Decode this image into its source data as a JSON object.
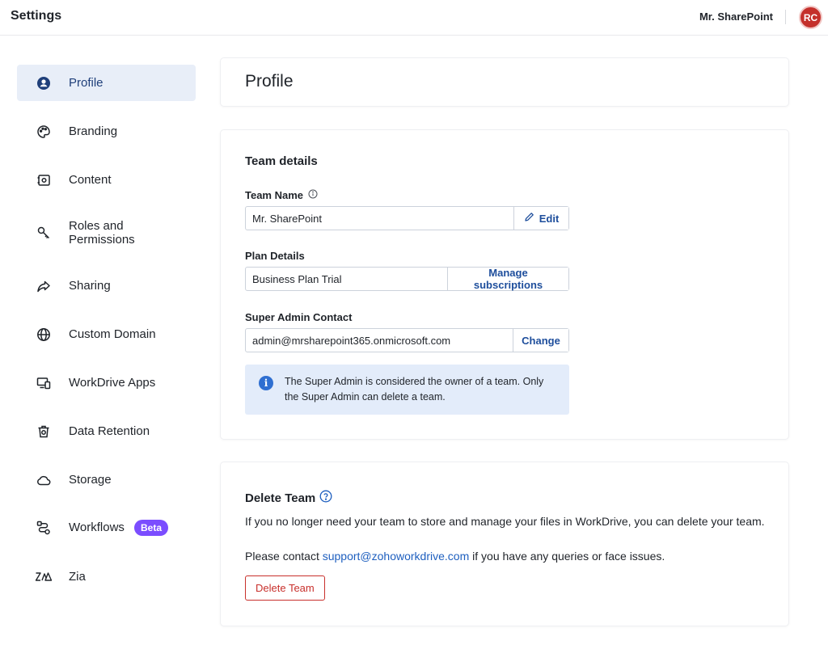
{
  "header": {
    "title": "Settings",
    "user_name": "Mr. SharePoint",
    "avatar_initials": "RC"
  },
  "sidebar": {
    "items": [
      {
        "label": "Profile",
        "icon": "profile-icon",
        "active": true
      },
      {
        "label": "Branding",
        "icon": "palette-icon"
      },
      {
        "label": "Content",
        "icon": "content-icon"
      },
      {
        "label": "Roles and Permissions",
        "icon": "key-icon"
      },
      {
        "label": "Sharing",
        "icon": "share-icon"
      },
      {
        "label": "Custom Domain",
        "icon": "globe-icon"
      },
      {
        "label": "WorkDrive Apps",
        "icon": "devices-icon"
      },
      {
        "label": "Data Retention",
        "icon": "trash-icon"
      },
      {
        "label": "Storage",
        "icon": "cloud-icon"
      },
      {
        "label": "Workflows",
        "icon": "workflow-icon",
        "badge": "Beta"
      },
      {
        "label": "Zia",
        "icon": "zia-icon"
      }
    ]
  },
  "profile": {
    "page_title": "Profile"
  },
  "team_details": {
    "section_title": "Team details",
    "team_name_label": "Team Name",
    "team_name_value": "Mr. SharePoint",
    "edit_label": "Edit",
    "plan_label": "Plan Details",
    "plan_value": "Business Plan Trial",
    "manage_label": "Manage subscriptions",
    "admin_label": "Super Admin Contact",
    "admin_value": "admin@mrsharepoint365.onmicrosoft.com",
    "change_label": "Change",
    "info_text": "The Super Admin is considered the owner of a team. Only the Super Admin can delete a team."
  },
  "delete_team": {
    "section_title": "Delete Team",
    "description": "If you no longer need your team to store and manage your files in WorkDrive, you can delete your team.",
    "contact_prefix": "Please contact ",
    "contact_link": "support@zohoworkdrive.com",
    "contact_suffix": " if you have any queries or face issues.",
    "button_label": "Delete Team"
  },
  "colors": {
    "accent": "#1e4e9c",
    "active_nav_bg": "#e8eef8",
    "info_bg": "#e3ecfa",
    "danger": "#c8302c",
    "beta_badge": "#7b4dff",
    "avatar": "#c4302b"
  }
}
